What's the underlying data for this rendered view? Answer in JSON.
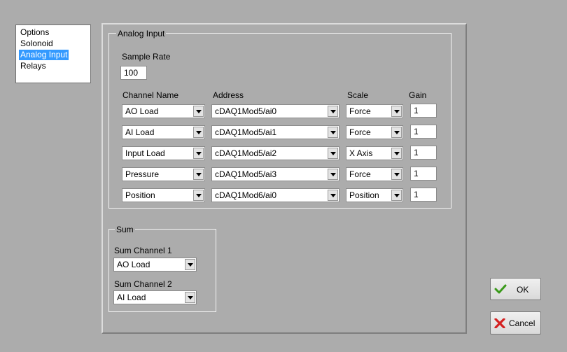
{
  "nav": {
    "items": [
      {
        "label": "Options"
      },
      {
        "label": "Solonoid"
      },
      {
        "label": "Analog Input"
      },
      {
        "label": "Relays"
      }
    ],
    "selected": "Analog Input"
  },
  "analog_input": {
    "title": "Analog Input",
    "sample_rate_label": "Sample Rate",
    "sample_rate_value": "100",
    "headers": {
      "channel": "Channel Name",
      "address": "Address",
      "scale": "Scale",
      "gain": "Gain"
    },
    "rows": [
      {
        "channel": "AO Load",
        "address": "cDAQ1Mod5/ai0",
        "scale": "Force",
        "gain": "1"
      },
      {
        "channel": "AI Load",
        "address": "cDAQ1Mod5/ai1",
        "scale": "Force",
        "gain": "1"
      },
      {
        "channel": "Input Load",
        "address": "cDAQ1Mod5/ai2",
        "scale": "X Axis",
        "gain": "1"
      },
      {
        "channel": "Pressure",
        "address": "cDAQ1Mod5/ai3",
        "scale": "Force",
        "gain": "1"
      },
      {
        "channel": "Position",
        "address": "cDAQ1Mod6/ai0",
        "scale": "Position",
        "gain": "1"
      }
    ]
  },
  "sum": {
    "title": "Sum",
    "channel1_label": "Sum Channel 1",
    "channel1_value": "AO Load",
    "channel2_label": "Sum Channel 2",
    "channel2_value": "AI Load"
  },
  "buttons": {
    "ok_label": "OK",
    "cancel_label": "Cancel"
  },
  "colors": {
    "background": "#acacac",
    "selection": "#3399ff",
    "ok_icon": "#3a9a1a",
    "cancel_icon": "#d42020"
  },
  "icons": {
    "ok": "checkmark-icon",
    "cancel": "x-icon",
    "dropdown": "chevron-down-icon"
  }
}
